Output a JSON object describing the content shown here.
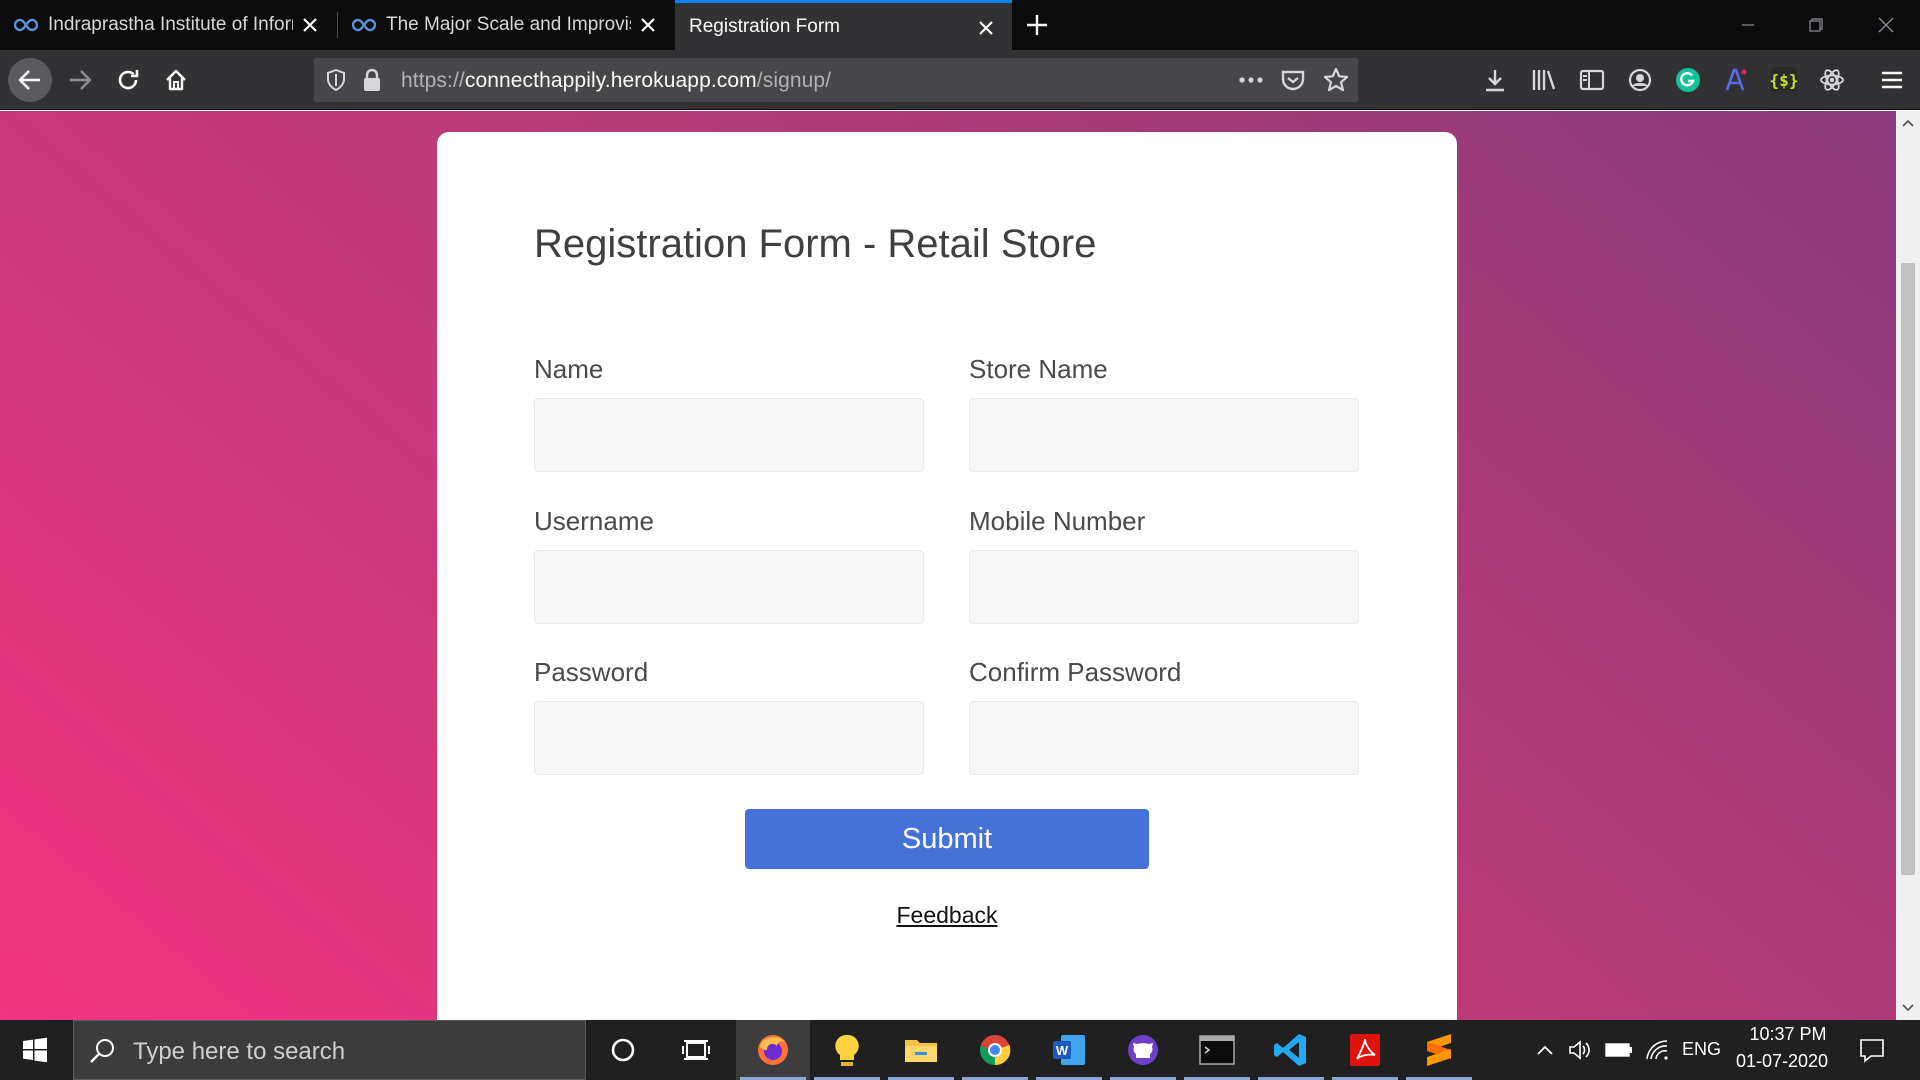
{
  "browser": {
    "tabs": [
      {
        "title": "Indraprastha Institute of Inform",
        "active": false
      },
      {
        "title": "The Major Scale and Improvisin",
        "active": false
      },
      {
        "title": "Registration Form",
        "active": true
      }
    ],
    "url_scheme": "https://",
    "url_host": "connecthappily.herokuapp.com",
    "url_path": "/signup/"
  },
  "form": {
    "title": "Registration Form - Retail Store",
    "fields": [
      {
        "label": "Name",
        "value": ""
      },
      {
        "label": "Store Name",
        "value": ""
      },
      {
        "label": "Username",
        "value": ""
      },
      {
        "label": "Mobile Number",
        "value": ""
      },
      {
        "label": "Password",
        "value": ""
      },
      {
        "label": "Confirm Password",
        "value": ""
      }
    ],
    "submit_label": "Submit",
    "feedback_label": "Feedback"
  },
  "taskbar": {
    "search_placeholder": "Type here to search",
    "apps": [
      "Firefox",
      "Tips",
      "File Explorer",
      "Chrome",
      "Word",
      "GitHub Desktop",
      "Command Prompt",
      "Visual Studio Code",
      "Adobe Acrobat",
      "Sublime Text"
    ],
    "language": "ENG",
    "time": "10:37 PM",
    "date": "01-07-2020"
  },
  "colors": {
    "accent_tab": "#0a84ff",
    "submit_button": "#4472d8",
    "gradient_start": "#f2337f",
    "gradient_end": "#8b3b7a"
  }
}
